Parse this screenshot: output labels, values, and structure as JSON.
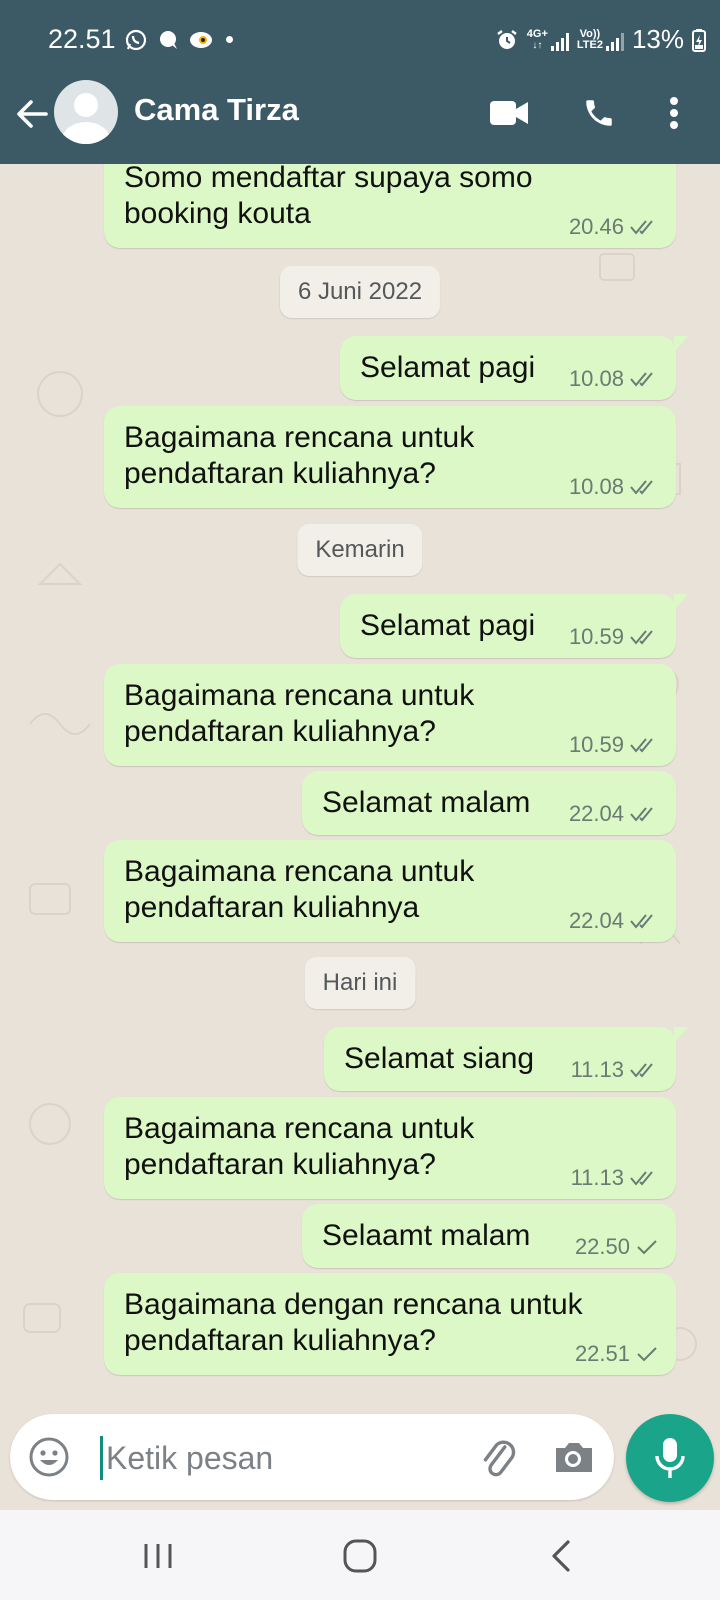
{
  "status_bar": {
    "time": "22.51",
    "network_type": "4G+",
    "volte_label_top": "Vo))",
    "volte_label_bottom": "LTE2",
    "battery": "13%"
  },
  "toolbar": {
    "contact_name": "Cama Tirza",
    "icons": [
      "back-arrow-icon",
      "avatar",
      "video-call-icon",
      "phone-icon",
      "more-vert-icon"
    ]
  },
  "messages": [
    {
      "type": "out",
      "text": "Somo mendaftar supaya somo booking kouta",
      "time": "20.46",
      "status": "read"
    },
    {
      "type": "date",
      "text": "6 Juni 2022"
    },
    {
      "type": "out",
      "text": "Selamat pagi",
      "time": "10.08",
      "status": "read"
    },
    {
      "type": "out",
      "text": "Bagaimana rencana untuk pendaftaran kuliahnya?",
      "time": "10.08",
      "status": "read"
    },
    {
      "type": "date",
      "text": "Kemarin"
    },
    {
      "type": "out",
      "text": "Selamat pagi",
      "time": "10.59",
      "status": "read"
    },
    {
      "type": "out",
      "text": "Bagaimana rencana untuk pendaftaran kuliahnya?",
      "time": "10.59",
      "status": "read"
    },
    {
      "type": "out",
      "text": "Selamat malam",
      "time": "22.04",
      "status": "read"
    },
    {
      "type": "out",
      "text": "Bagaimana rencana untuk pendaftaran kuliahnya",
      "time": "22.04",
      "status": "read"
    },
    {
      "type": "date",
      "text": "Hari ini"
    },
    {
      "type": "out",
      "text": "Selamat siang",
      "time": "11.13",
      "status": "read"
    },
    {
      "type": "out",
      "text": "Bagaimana rencana untuk pendaftaran kuliahnya?",
      "time": "11.13",
      "status": "read"
    },
    {
      "type": "out",
      "text": "Selaamt malam",
      "time": "22.50",
      "status": "sent"
    },
    {
      "type": "out",
      "text": "Bagaimana dengan rencana untuk pendaftaran kuliahnya?",
      "time": "22.51",
      "status": "sent"
    }
  ],
  "composer": {
    "placeholder": "Ketik pesan",
    "icons": [
      "emoji-icon",
      "attach-icon",
      "camera-icon",
      "mic-icon"
    ]
  },
  "colors": {
    "header": "#3c5a66",
    "bubble_out": "#dcf8c6",
    "chat_background": "#e9e2d8",
    "mic_button": "#1aa58a"
  },
  "nav_bar": {
    "icons": [
      "recent-apps-icon",
      "home-icon",
      "back-icon"
    ]
  }
}
